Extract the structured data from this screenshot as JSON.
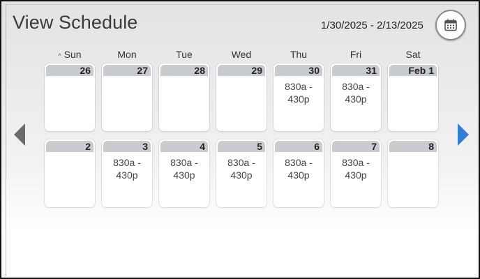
{
  "header": {
    "title": "View Schedule",
    "date_range": "1/30/2025 - 2/13/2025"
  },
  "icons": {
    "calendar": "calendar-icon",
    "prev": "chevron-left-icon",
    "next": "chevron-right-icon",
    "sort": "caret-up-icon"
  },
  "colors": {
    "next_arrow": "#2f7fd7",
    "prev_arrow": "#6b6b6b",
    "day_band": "#c8cbd0"
  },
  "days": [
    "Sun",
    "Mon",
    "Tue",
    "Wed",
    "Thu",
    "Fri",
    "Sat"
  ],
  "sort_marker": "^",
  "weeks": [
    [
      {
        "day": "26",
        "shift": [
          "",
          ""
        ]
      },
      {
        "day": "27",
        "shift": [
          "",
          ""
        ]
      },
      {
        "day": "28",
        "shift": [
          "",
          ""
        ]
      },
      {
        "day": "29",
        "shift": [
          "",
          ""
        ]
      },
      {
        "day": "30",
        "shift": [
          "830a -",
          "430p"
        ]
      },
      {
        "day": "31",
        "shift": [
          "830a -",
          "430p"
        ]
      },
      {
        "day": "Feb 1",
        "shift": [
          "",
          ""
        ]
      }
    ],
    [
      {
        "day": "2",
        "shift": [
          "",
          ""
        ]
      },
      {
        "day": "3",
        "shift": [
          "830a -",
          "430p"
        ]
      },
      {
        "day": "4",
        "shift": [
          "830a -",
          "430p"
        ]
      },
      {
        "day": "5",
        "shift": [
          "830a -",
          "430p"
        ]
      },
      {
        "day": "6",
        "shift": [
          "830a -",
          "430p"
        ]
      },
      {
        "day": "7",
        "shift": [
          "830a -",
          "430p"
        ]
      },
      {
        "day": "8",
        "shift": [
          "",
          ""
        ]
      }
    ]
  ]
}
